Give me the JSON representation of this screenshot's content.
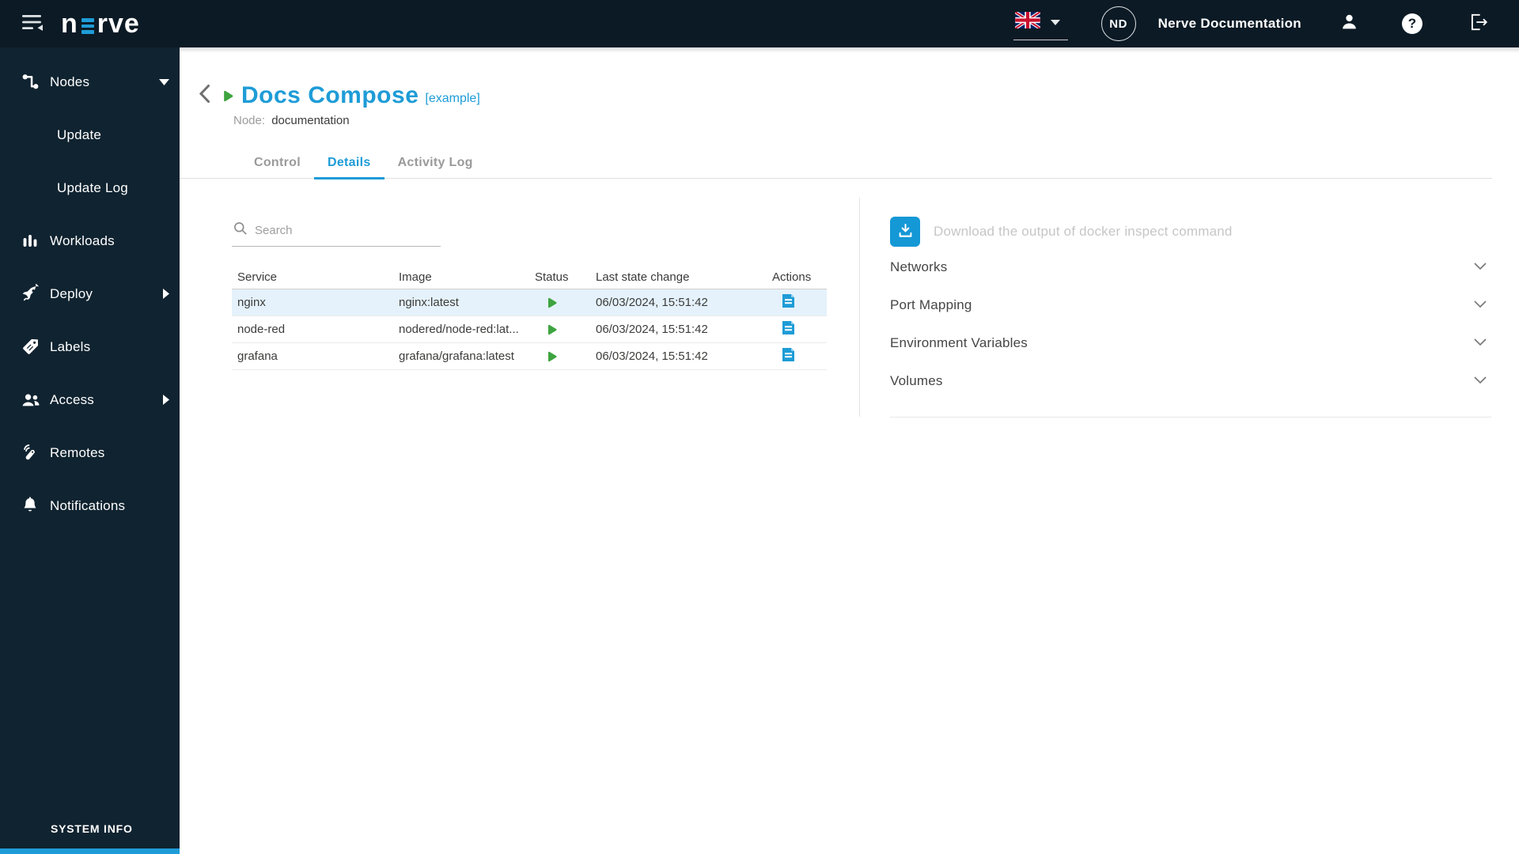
{
  "header": {
    "logo_text_start": "n",
    "logo_text_end": "rve",
    "language_flag": "uk-flag",
    "avatar_initials": "ND",
    "account_name": "Nerve Documentation"
  },
  "sidebar": {
    "items": [
      {
        "label": "Nodes",
        "icon": "nodes-icon",
        "arrow": "caret-down",
        "expanded": true
      },
      {
        "label": "Update",
        "sub": true
      },
      {
        "label": "Update Log",
        "sub": true
      },
      {
        "label": "Workloads",
        "icon": "workloads-icon"
      },
      {
        "label": "Deploy",
        "icon": "deploy-icon",
        "arrow": "chevron-right"
      },
      {
        "label": "Labels",
        "icon": "labels-icon"
      },
      {
        "label": "Access",
        "icon": "access-icon",
        "arrow": "chevron-right"
      },
      {
        "label": "Remotes",
        "icon": "remotes-icon"
      },
      {
        "label": "Notifications",
        "icon": "notifications-icon"
      }
    ],
    "footer_label": "SYSTEM INFO"
  },
  "workload": {
    "title": "Docs Compose",
    "tag": "[example]",
    "status": "started",
    "node_label": "Node:",
    "node_value": "documentation"
  },
  "tabs": [
    {
      "label": "Control",
      "active": false
    },
    {
      "label": "Details",
      "active": true
    },
    {
      "label": "Activity Log",
      "active": false
    }
  ],
  "services_table": {
    "search_placeholder": "Search",
    "columns": [
      "Service",
      "Image",
      "Status",
      "Last state change",
      "Actions"
    ],
    "rows": [
      {
        "service": "nginx",
        "image": "nginx:latest",
        "status": "started",
        "last_state_change": "06/03/2024, 15:51:42",
        "highlighted": true
      },
      {
        "service": "node-red",
        "image": "nodered/node-red:lat...",
        "status": "started",
        "last_state_change": "06/03/2024, 15:51:42",
        "highlighted": false
      },
      {
        "service": "grafana",
        "image": "grafana/grafana:latest",
        "status": "started",
        "last_state_change": "06/03/2024, 15:51:42",
        "highlighted": false
      }
    ]
  },
  "inspect_panel": {
    "download_label": "Download the output of docker inspect command",
    "sections": [
      {
        "label": "Networks"
      },
      {
        "label": "Port Mapping"
      },
      {
        "label": "Environment Variables"
      },
      {
        "label": "Volumes"
      }
    ]
  },
  "colors": {
    "accent_blue": "#1e9cd7",
    "status_green": "#3ea440",
    "header_bg": "#0b1a25",
    "sidebar_bg": "#102330",
    "row_highlight": "#e5f2fb"
  }
}
